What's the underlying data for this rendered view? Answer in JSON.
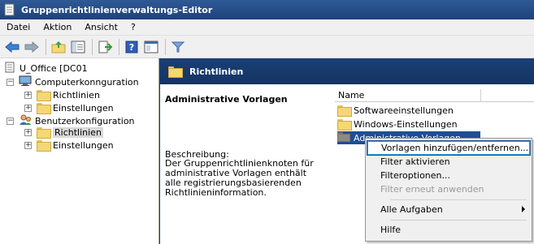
{
  "window": {
    "title": "Gruppenrichtlinienverwaltungs-Editor"
  },
  "menu": {
    "items": [
      "Datei",
      "Aktion",
      "Ansicht",
      "?"
    ]
  },
  "toolbar": {
    "icons": [
      "back-arrow-icon",
      "forward-arrow-icon",
      "up-folder-icon",
      "show-hide-tree-icon",
      "export-list-icon",
      "help-icon",
      "console-icon",
      "filter-icon"
    ]
  },
  "tree": {
    "root": "U_Office [DC01",
    "computer": "Computerkonnguration",
    "computer_children": [
      "Richtlinien",
      "Einstellungen"
    ],
    "user": "Benutzerkonfiguration",
    "user_children": [
      "Richtlinien",
      "Einstellungen"
    ]
  },
  "right": {
    "header": "Richtlinien",
    "desc_title": "Administrative Vorlagen",
    "desc_label": "Beschreibung:",
    "desc_text": "Der Gruppenrichtlinienknoten für administrative Vorlagen enthält alle registrierungsbasierenden Richtlinieninformation.",
    "column": "Name",
    "items": [
      "Softwareeinstellungen",
      "Windows-Einstellungen",
      "Administrative Vorlagen"
    ]
  },
  "context_menu": {
    "items": [
      "Vorlagen hinzufügen/entfernen...",
      "Filter aktivieren",
      "Filteroptionen...",
      "Filter erneut anwenden",
      "Alle Aufgaben",
      "Hilfe"
    ]
  }
}
